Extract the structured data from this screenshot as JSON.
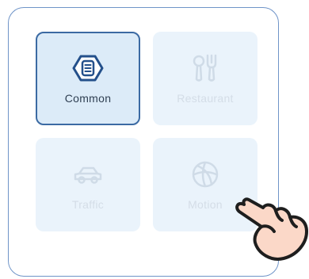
{
  "options": [
    {
      "label": "Common",
      "icon": "hexagon-menu-icon",
      "selected": true
    },
    {
      "label": "Restaurant",
      "icon": "spoon-fork-icon",
      "selected": false
    },
    {
      "label": "Traffic",
      "icon": "car-icon",
      "selected": false
    },
    {
      "label": "Motion",
      "icon": "basketball-icon",
      "selected": false
    }
  ],
  "colors": {
    "accent": "#3b6aa3",
    "tile_background": "#eaf3fb",
    "selected_background": "#dcebf8",
    "inactive_text": "#d4dde7",
    "active_text": "#2f3f52",
    "hand_skin": "#fbd8c8"
  },
  "pointer": {
    "icon": "pointing-hand-icon"
  }
}
